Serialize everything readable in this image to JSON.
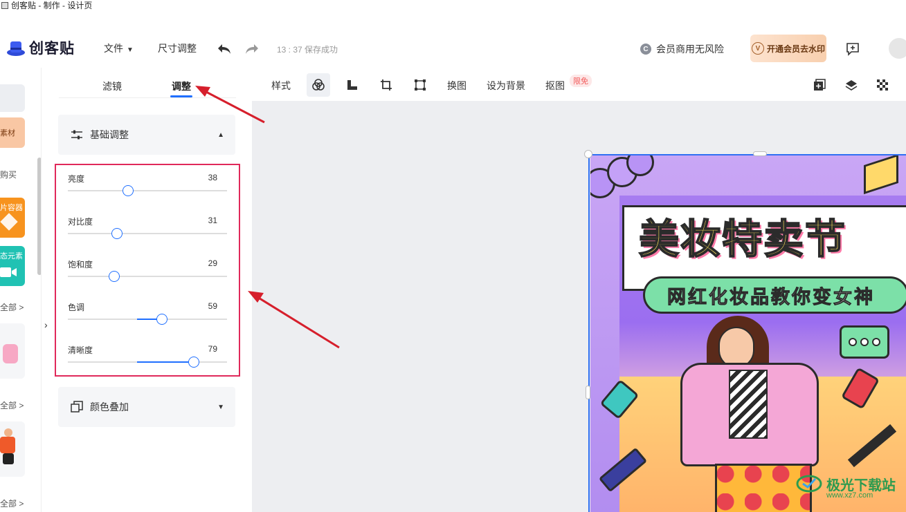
{
  "window": {
    "title": "创客贴 - 制作 - 设计页"
  },
  "header": {
    "logo_text": "创客贴",
    "menu": {
      "file": "文件",
      "resize": "尺寸调整"
    },
    "save_status": "13 : 37 保存成功",
    "commercial": "会员商用无风险",
    "vip_button": "开通会员去水印",
    "vip_badge": "V"
  },
  "left_strip": {
    "item_material": "素材",
    "item_buy": "购买",
    "item_container": "片容器",
    "item_dynamic": "态元素",
    "view_all_1": "全部 >",
    "view_all_2": "全部 >",
    "view_all_3": "全部 >"
  },
  "panel": {
    "tabs": [
      "滤镜",
      "调整"
    ],
    "active_tab": 1,
    "basic_section": "基础调整",
    "color_section": "颜色叠加",
    "sliders": [
      {
        "label": "亮度",
        "value": "38",
        "level": 38
      },
      {
        "label": "对比度",
        "value": "31",
        "level": 31
      },
      {
        "label": "饱和度",
        "value": "29",
        "level": 29
      },
      {
        "label": "色调",
        "value": "59",
        "level": 59
      },
      {
        "label": "清晰度",
        "value": "79",
        "level": 79
      }
    ]
  },
  "toolbar": {
    "style": "样式",
    "replace": "换图",
    "set_bg": "设为背景",
    "cutout": "抠图",
    "free_badge": "限免"
  },
  "poster": {
    "title": "美妆特卖节",
    "subtitle": "网红化妆品教你变女神"
  },
  "watermark": {
    "text": "极光下载站",
    "url": "www.xz7.com"
  },
  "colors": {
    "accent": "#1f6fff",
    "highlight_border": "#e0285a",
    "arrow": "#d61f2c"
  }
}
